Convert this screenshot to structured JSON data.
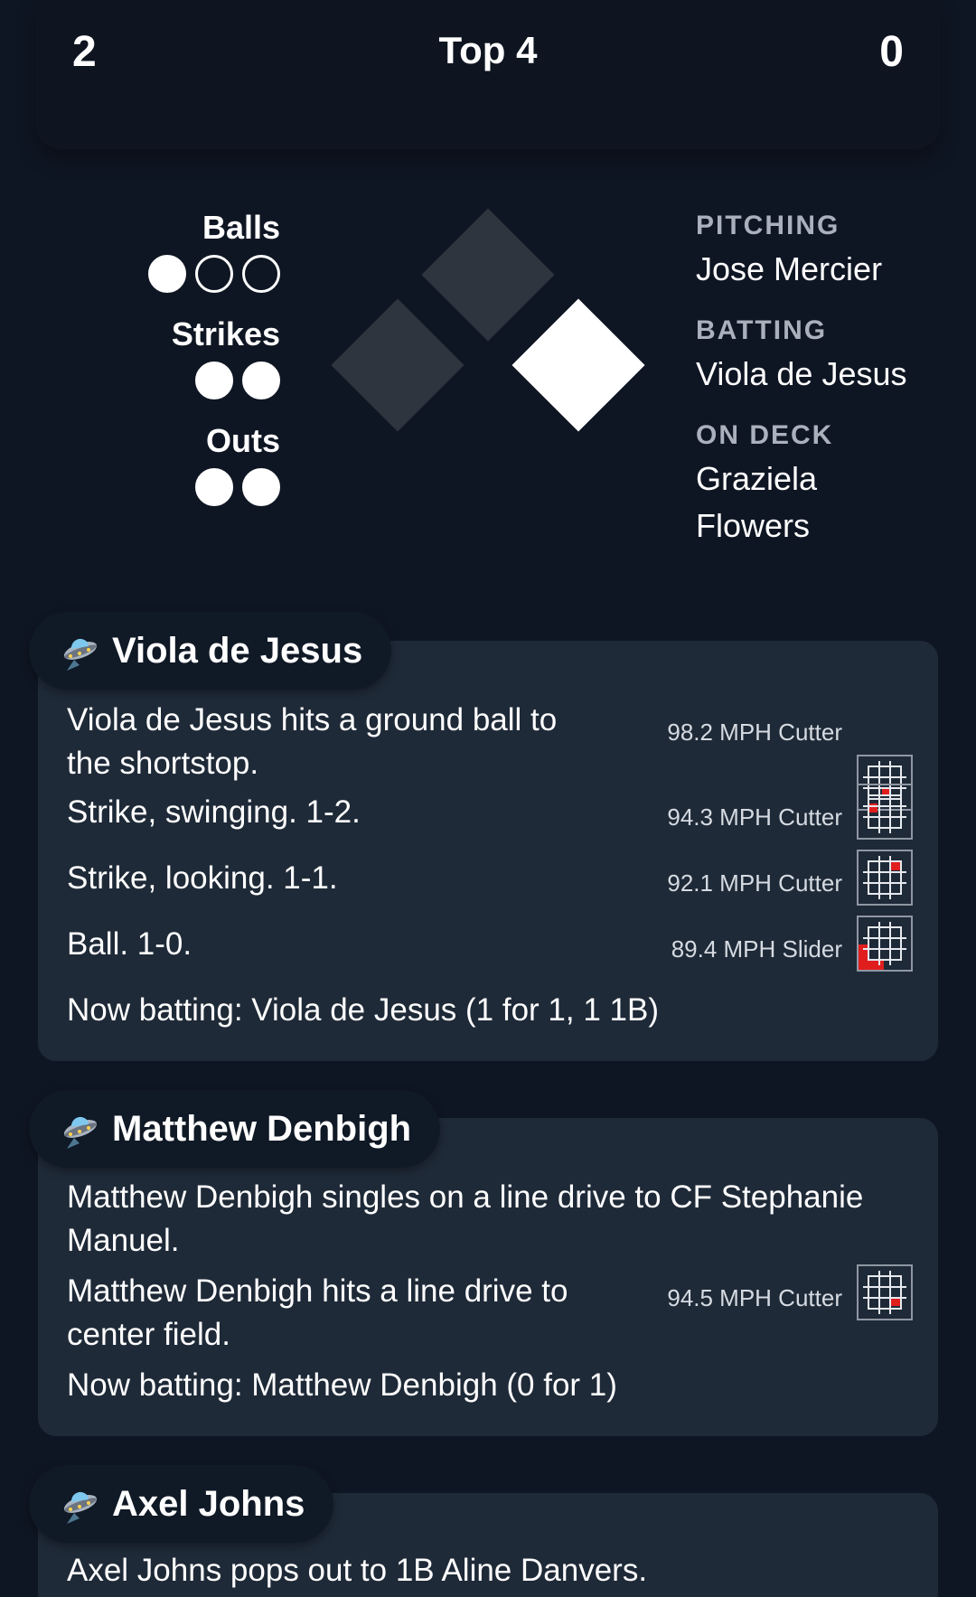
{
  "score": {
    "away": "2",
    "inning": "Top 4",
    "home": "0"
  },
  "count": {
    "balls_label": "Balls",
    "strikes_label": "Strikes",
    "outs_label": "Outs",
    "balls": 1,
    "balls_max": 3,
    "strikes": 2,
    "strikes_max": 2,
    "outs": 2,
    "outs_max": 2
  },
  "bases": {
    "first": true,
    "second": false,
    "third": false
  },
  "matchup": {
    "pitching_label": "PITCHING",
    "pitching_name": "Jose Mercier",
    "batting_label": "BATTING",
    "batting_name": "Viola de Jesus",
    "on_deck_label": "ON DECK",
    "on_deck_name_line1": "Graziela",
    "on_deck_name_line2": "Flowers"
  },
  "colors": {
    "background": "#0f1623",
    "card": "#1f2a38",
    "pill": "#101926",
    "pitch_location": "#e01e1e"
  },
  "plays": [
    {
      "batter": "Viola de Jesus",
      "icon": "ufo-icon",
      "events": [
        {
          "text": "Viola de Jesus hits a ground ball to the shortstop.",
          "pitch": "98.2 MPH Cutter",
          "zone": "low-middle"
        },
        {
          "text": "Strike, swinging. 1-2.",
          "pitch": "94.3 MPH Cutter",
          "zone": "middle-left"
        },
        {
          "text": "Strike, looking. 1-1.",
          "pitch": "92.1 MPH Cutter",
          "zone": "up-right"
        },
        {
          "text": "Ball. 1-0.",
          "pitch": "89.4 MPH Slider",
          "zone": "outside-low-left"
        },
        {
          "text": "Now batting: Viola de Jesus (1 for 1, 1 1B)"
        }
      ]
    },
    {
      "batter": "Matthew Denbigh",
      "icon": "ufo-icon",
      "events": [
        {
          "text": "Matthew Denbigh singles on a line drive to CF Stephanie Manuel."
        },
        {
          "text": "Matthew Denbigh hits a line drive to center field.",
          "pitch": "94.5 MPH Cutter",
          "zone": "low-right"
        },
        {
          "text": "Now batting: Matthew Denbigh (0 for 1)"
        }
      ]
    },
    {
      "batter": "Axel Johns",
      "icon": "ufo-icon",
      "events": [
        {
          "text": "Axel Johns pops out to 1B Aline Danvers."
        }
      ]
    }
  ]
}
